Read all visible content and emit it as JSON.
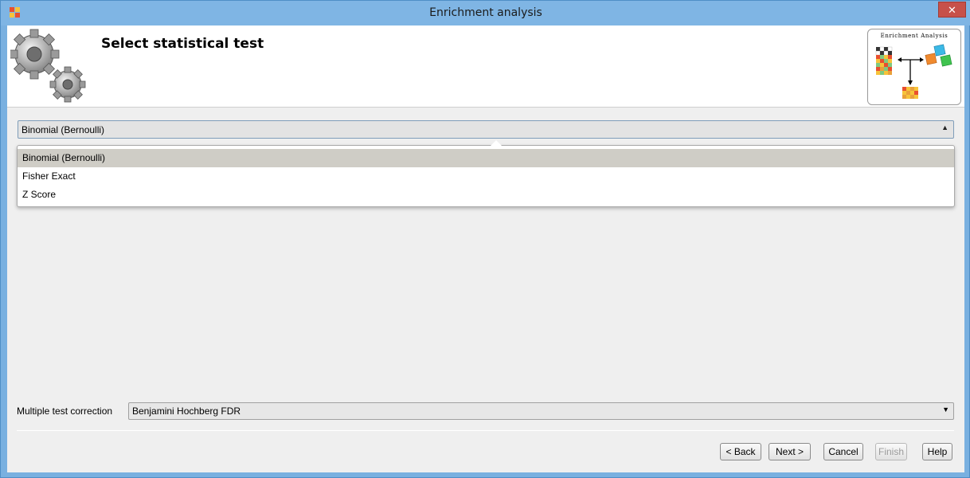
{
  "window": {
    "title": "Enrichment analysis",
    "close_label": "✕"
  },
  "header": {
    "step_title": "Select statistical test",
    "logo_title": "Enrichment Analysis"
  },
  "test_combo": {
    "value": "Binomial (Bernoulli)"
  },
  "test_options": [
    "Binomial (Bernoulli)",
    "Fisher Exact",
    "Z Score"
  ],
  "correction": {
    "label": "Multiple test correction",
    "value": "Benjamini Hochberg FDR"
  },
  "buttons": {
    "back": "< Back",
    "next": "Next >",
    "cancel": "Cancel",
    "finish": "Finish",
    "help": "Help"
  },
  "colors": {
    "title_bar": "#7fb5e4",
    "close": "#c7514a",
    "selection": "#cfcdc6"
  }
}
